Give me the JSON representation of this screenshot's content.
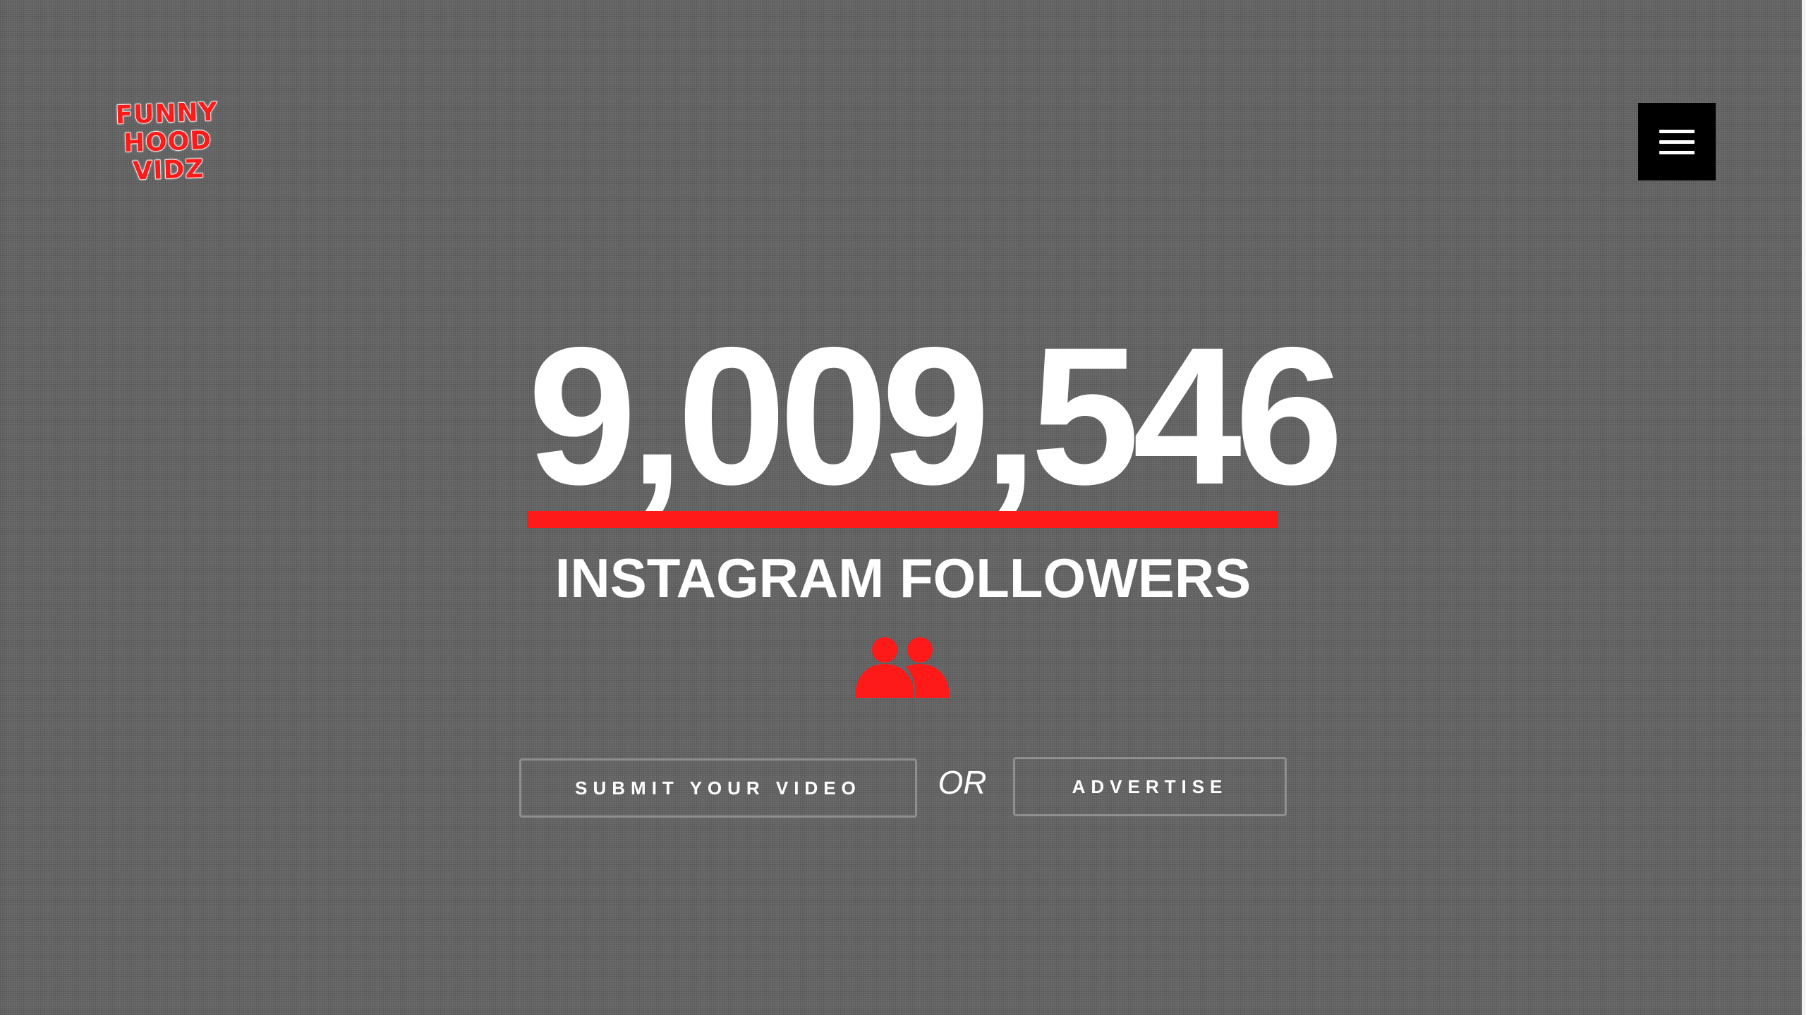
{
  "logo": {
    "line1": "FUNNY",
    "line2": "HOOD",
    "line3": "VIDZ"
  },
  "header": {
    "menu_icon": "hamburger-menu-icon"
  },
  "hero": {
    "follower_count": "9,009,546",
    "follower_label": "INSTAGRAM FOLLOWERS",
    "icon": "users-icon"
  },
  "actions": {
    "submit_label": "SUBMIT YOUR VIDEO",
    "or_label": "OR",
    "advertise_label": "ADVERTISE"
  },
  "colors": {
    "accent": "#ff1a1a",
    "background": "#6b6b6b",
    "text": "#ffffff",
    "menu_bg": "#000000"
  }
}
